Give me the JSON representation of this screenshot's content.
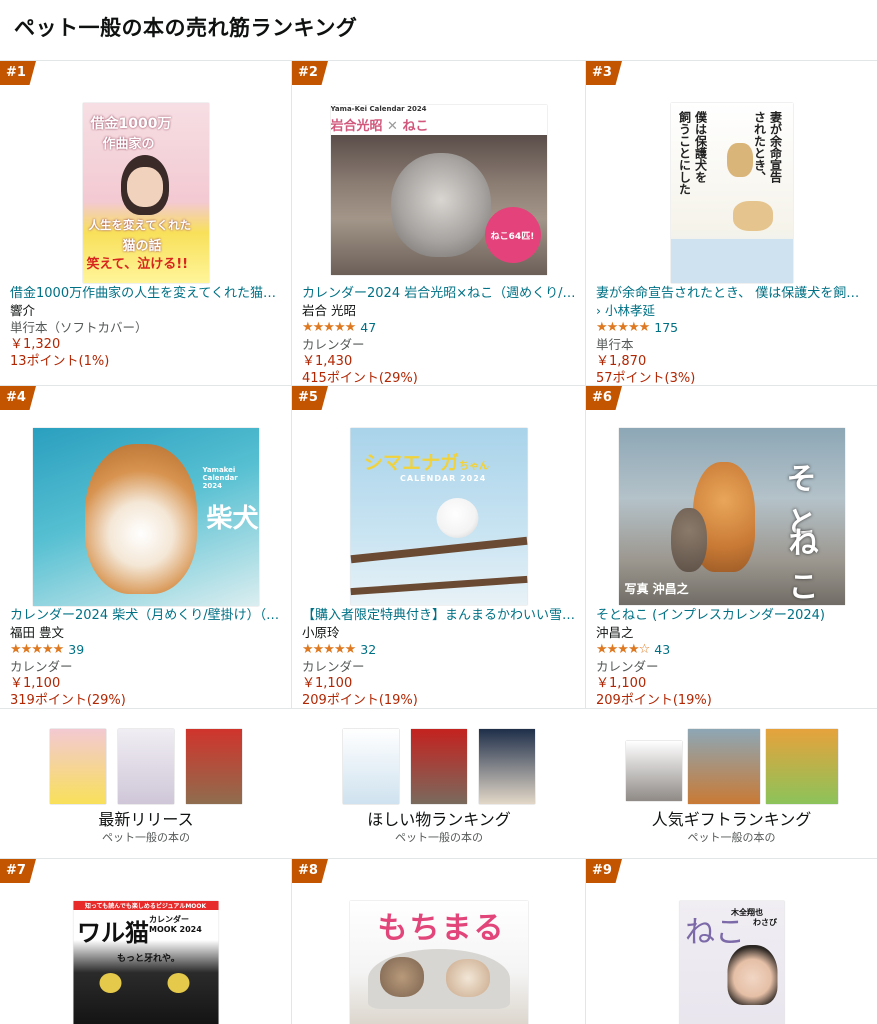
{
  "page": {
    "title": "ペット一般の本の売れ筋ランキング"
  },
  "products": [
    {
      "rank": "#1",
      "title": "借金1000万作曲家の人生を変えてくれた猫…",
      "author": "響介",
      "format": "単行本（ソフトカバー）",
      "price": "￥1,320",
      "points": "13ポイント(1%)",
      "cover": {
        "line1": "借金1000万",
        "line2": "作曲家の",
        "line3": "人生を変えてくれた",
        "line4": "猫の話",
        "band": "笑えて、泣ける!!"
      }
    },
    {
      "rank": "#2",
      "title": "カレンダー2024 岩合光昭×ねこ（週めくり/…",
      "author": "岩合 光昭",
      "rating": "47",
      "format": "カレンダー",
      "price": "￥1,430",
      "points": "415ポイント(29%)",
      "cover": {
        "small": "Yama-Kei Calendar 2024",
        "head": "岩合光昭",
        "cross": "✕",
        "cat": "ねこ",
        "badge": "ねこ64匹!"
      }
    },
    {
      "rank": "#3",
      "title": "妻が余命宣告されたとき、 僕は保護犬を飼う…",
      "author": "› 小林孝延",
      "rating": "175",
      "format": "単行本",
      "price": "￥1,870",
      "points": "57ポイント(3%)",
      "cover": {
        "v1": "妻が余命宣告",
        "v2": "されたとき、",
        "v3": "僕は保護犬を",
        "v4": "飼うことにした"
      }
    },
    {
      "rank": "#4",
      "title": "カレンダー2024 柴犬（月めくり/壁掛け）（…",
      "author": "福田 豊文",
      "rating": "39",
      "format": "カレンダー",
      "price": "￥1,100",
      "points": "319ポイント(29%)",
      "cover": {
        "small": "Yamakei Calendar 2024",
        "main": "柴犬"
      }
    },
    {
      "rank": "#5",
      "title": "【購入者限定特典付き】まんまるかわいい雪…",
      "author": "小原玲",
      "rating": "32",
      "format": "カレンダー",
      "price": "￥1,100",
      "points": "209ポイント(19%)",
      "cover": {
        "main": "シマエナガ",
        "chan": "ちゃん",
        "sub": "CALENDAR 2024"
      }
    },
    {
      "rank": "#6",
      "title": "そとねこ (インプレスカレンダー2024)",
      "author": "沖昌之",
      "rating": "43",
      "format": "カレンダー",
      "price": "￥1,100",
      "points": "209ポイント(19%)",
      "cover": {
        "v1": "そと",
        "v2": "ねこ",
        "credit": "写真 沖昌之"
      }
    },
    {
      "rank": "#7",
      "cover": {
        "top": "知っても読んでも楽しめるビジュアルMOOK",
        "main": "ワル猫",
        "side": "カレンダー MOOK 2024",
        "sub": "もっと牙れや。"
      }
    },
    {
      "rank": "#8",
      "cover": {
        "main": "もちまる"
      }
    },
    {
      "rank": "#9",
      "cover": {
        "main": "ねこ",
        "name": "木全翔也",
        "name2": "わさび"
      }
    }
  ],
  "ratings_stars": {
    "p2": "★★★★★",
    "p3": "★★★★★",
    "p4": "★★★★★",
    "p5": "★★★★★",
    "p6": "★★★★☆"
  },
  "promos": [
    {
      "title": "最新リリース",
      "subtitle": "ペット一般の本の"
    },
    {
      "title": "ほしい物ランキング",
      "subtitle": "ペット一般の本の"
    },
    {
      "title": "人気ギフトランキング",
      "subtitle": "ペット一般の本の"
    }
  ],
  "colors": {
    "badge": "#c45500",
    "link": "#007185",
    "price": "#b12704",
    "star": "#de7921"
  }
}
